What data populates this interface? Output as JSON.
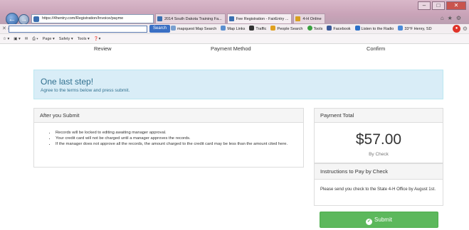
{
  "browser": {
    "address": "https://4hentry.com/Registration/Invoice/payme",
    "tabs": [
      {
        "label": "2014 South Dakota Training Fa..."
      },
      {
        "label": "Fee Registration - FairEntry ..."
      },
      {
        "label": "4-H Online"
      }
    ],
    "search_button": "Search",
    "toolbar_items": [
      "mapquest Map Search",
      "Map Links",
      "Traffic",
      "People Search",
      "Tools",
      "Facebook",
      "Listen to the Radio",
      "33°F Henry, SD"
    ],
    "command_items": [
      "Page ▾",
      "Safety ▾",
      "Tools ▾"
    ]
  },
  "steps": {
    "review": "Review",
    "payment": "Payment Method",
    "confirm": "Confirm"
  },
  "alert": {
    "title": "One last step!",
    "text": "Agree to the terms below and press submit."
  },
  "after_submit": {
    "heading": "After you Submit",
    "bullets": [
      "Records will be locked to editing awaiting manager approval.",
      "Your credit card will not be charged until a manager approves the records.",
      "If the manager does not approve all the records, the amount charged to the credit card may be less than the amount cited here."
    ]
  },
  "payment_total": {
    "heading": "Payment Total",
    "amount": "$57.00",
    "method": "By Check"
  },
  "instructions": {
    "heading": "Instructions to Pay by Check",
    "text": "Please send you check to the State 4-H Office by August 1st."
  },
  "submit_label": "Submit"
}
